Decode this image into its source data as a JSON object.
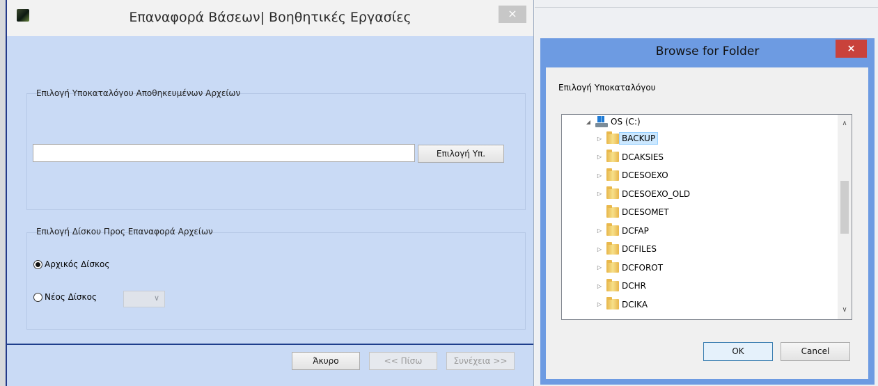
{
  "restore_dialog": {
    "title": "Επαναφορά Βάσεων| Βοηθητικές Εργασίες",
    "close_label": "×",
    "folder_group_label": "Επιλογή Υποκαταλόγου Αποθηκευμένων Αρχείων",
    "path_value": "",
    "select_folder_button": "Επιλογή Υπ.",
    "disk_group_label": "Επιλογή Δίσκου Προς Επαναφορά Αρχείων",
    "radio_original": "Αρχικός Δίσκος",
    "radio_original_selected": true,
    "radio_new": "Νέος Δίσκος",
    "radio_new_selected": false,
    "new_disk_value": "",
    "cancel_button": "Άκυρο",
    "back_button": "<< Πίσω",
    "next_button": "Συνέχεια >>"
  },
  "browse_dialog": {
    "title": "Browse for Folder",
    "close_label": "×",
    "prompt": "Επιλογή Υποκαταλόγου",
    "drive_label": "OS (C:)",
    "folders": [
      {
        "name": "BACKUP",
        "expandable": true,
        "selected": true
      },
      {
        "name": "DCAKSIES",
        "expandable": true,
        "selected": false
      },
      {
        "name": "DCESOEXO",
        "expandable": true,
        "selected": false
      },
      {
        "name": "DCESOEXO_OLD",
        "expandable": true,
        "selected": false
      },
      {
        "name": "DCESOMET",
        "expandable": false,
        "selected": false
      },
      {
        "name": "DCFAP",
        "expandable": true,
        "selected": false
      },
      {
        "name": "DCFILES",
        "expandable": true,
        "selected": false
      },
      {
        "name": "DCFOROT",
        "expandable": true,
        "selected": false
      },
      {
        "name": "DCHR",
        "expandable": true,
        "selected": false
      },
      {
        "name": "DCIKA",
        "expandable": true,
        "selected": false
      }
    ],
    "ok_button": "OK",
    "cancel_button": "Cancel"
  },
  "colors": {
    "dialog_bg": "#c9daf5",
    "browse_frame": "#6d9be2",
    "separator": "#1e3e8c",
    "close_red": "#c9423b"
  }
}
